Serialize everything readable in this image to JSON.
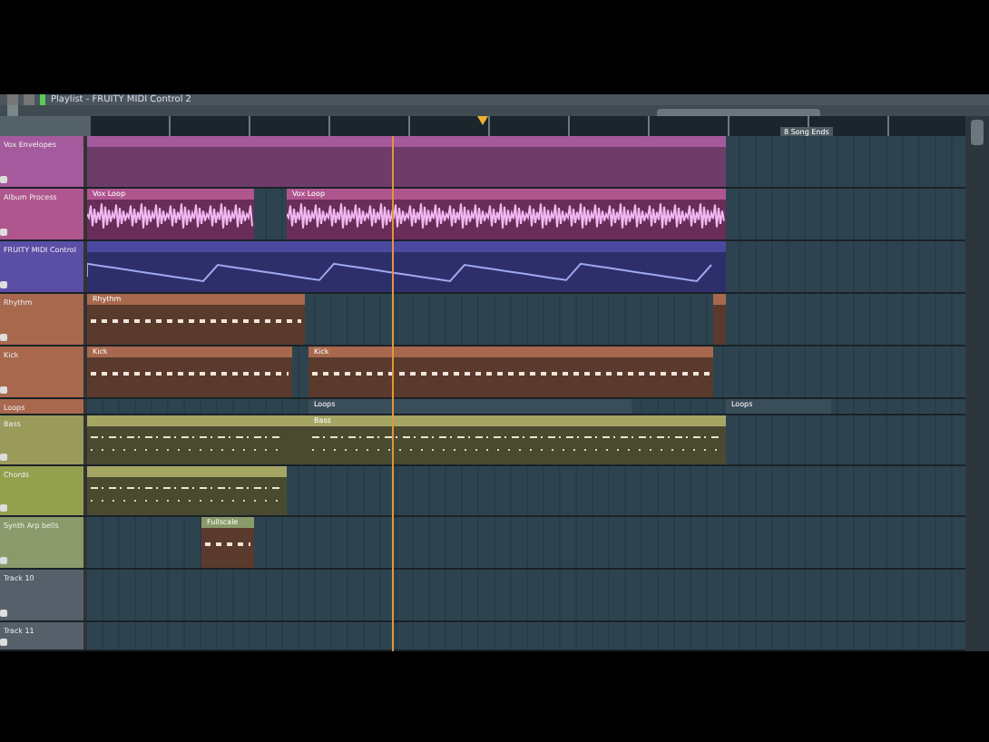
{
  "window": {
    "title": "Playlist - FRUITY MIDI Control 2"
  },
  "ruler": {
    "marker": "8 Song Ends"
  },
  "tracks": [
    {
      "name": "Vox Envelopes",
      "color": "#a45a9c",
      "clips": [
        {
          "kind": "plain"
        }
      ]
    },
    {
      "name": "Album Process",
      "color": "#b0568f",
      "clips": [
        {
          "kind": "audio",
          "label": "Vox Loop"
        },
        {
          "kind": "audio",
          "label": "Vox Loop"
        }
      ]
    },
    {
      "name": "FRUITY MIDI Control",
      "color": "#5a4ea6",
      "clips": [
        {
          "kind": "automation"
        }
      ]
    },
    {
      "name": "Rhythm",
      "color": "#a8684e",
      "clips": [
        {
          "kind": "pattern",
          "label": "Rhythm"
        },
        {
          "kind": "pattern"
        }
      ]
    },
    {
      "name": "Kick",
      "color": "#a8684e",
      "clips": [
        {
          "kind": "pattern",
          "label": "Kick"
        },
        {
          "kind": "pattern",
          "label": "Kick"
        }
      ]
    },
    {
      "name": "Loops",
      "color": "#a8684e",
      "clips": [
        {
          "kind": "marker",
          "label": "Loops"
        },
        {
          "kind": "marker",
          "label": "Loops"
        }
      ]
    },
    {
      "name": "Bass",
      "color": "#9a9a5a",
      "clips": [
        {
          "kind": "notes"
        },
        {
          "kind": "notes"
        },
        {
          "kind": "notes",
          "label": "Bass"
        }
      ]
    },
    {
      "name": "Chords",
      "color": "#93a04e",
      "clips": [
        {
          "kind": "notes"
        }
      ]
    },
    {
      "name": "Synth Arp bells",
      "color": "#8a9a6a",
      "clips": [
        {
          "kind": "pattern",
          "label": "Fullscale"
        }
      ]
    },
    {
      "name": "Track 10",
      "color": "#55606a"
    },
    {
      "name": "Track 11",
      "color": "#55606a"
    }
  ]
}
